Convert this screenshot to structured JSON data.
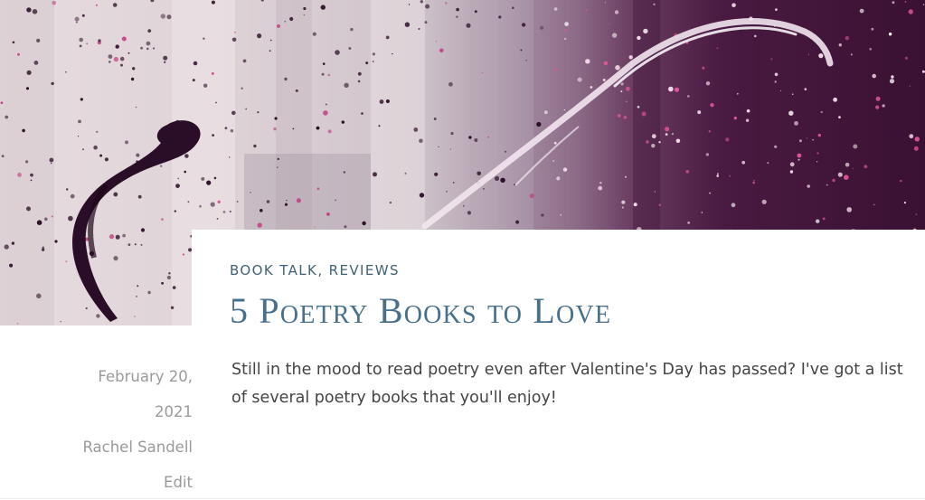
{
  "post": {
    "categories": [
      "Book Talk",
      "Reviews"
    ],
    "category_separator": ", ",
    "title": "5 Poetry Books to Love",
    "excerpt": "Still in the mood to read poetry even after Valentine's Day has passed? I've got a list of several poetry books that you'll enjoy!",
    "date_line_1": "February 20,",
    "date_line_2": "2021",
    "author": "Rachel Sandell",
    "edit_label": "Edit"
  },
  "colors": {
    "accent": "#46708c",
    "category": "#3f6277",
    "text": "#444444",
    "meta": "#9a9a9a",
    "hero_dark": "#3a1030",
    "hero_light": "#e8dde0"
  }
}
